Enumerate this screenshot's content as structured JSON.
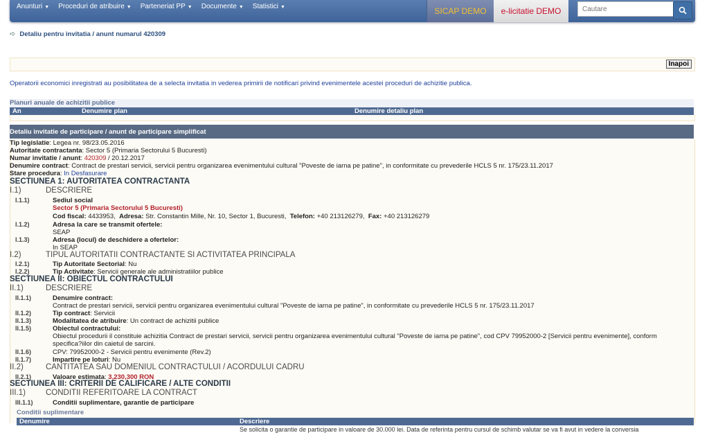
{
  "nav": {
    "menu": [
      "Anunturi",
      "Proceduri de atribuire",
      "Parteneriat PP",
      "Documente",
      "Statistici"
    ],
    "sicap": "SICAP DEMO",
    "elicitatie": "e-licitatie DEMO",
    "search_placeholder": "Cautare"
  },
  "breadcrumb": "Detaliu pentru invitatia / anunt numarul 420309",
  "back_label": "Inapoi",
  "notice": "Operatorii economici inregistrati au posibilitatea de a selecta invitatia in vederea primirii de notificari privind evenimentele acestei proceduri de achizitie publica.",
  "plans": {
    "title": "Planuri anuale de achizitii publice",
    "headers": [
      "An",
      "Denumire plan",
      "Denumire detaliu plan"
    ]
  },
  "detail": {
    "title": "Detaliu invitatie de participare / anunt de participare simplificat",
    "tip_label": "Tip legislatie",
    "tip_value": ": Legea nr. 98/23.05.2016",
    "autoritate_label": "Autoritate contractanta",
    "autoritate_value": ": Sector 5 (Primaria Sectorului 5 Bucuresti)",
    "numar_label": "Numar invitatie / anunt",
    "numar_value": "420309",
    "numar_date": " / 20.12.2017",
    "denumire_label": "Denumire contract",
    "denumire_value": ": Contract de prestari servicii, servicii pentru organizarea evenimentului cultural \"Poveste de iarna pe patine\", in conformitate cu prevederile HCLS 5 nr. 175/23.11.2017",
    "stare_label": "Stare procedura",
    "stare_value": "In Desfasurare"
  },
  "s1": {
    "title": "SECTIUNEA 1: AUTORITATEA CONTRACTANTA",
    "i1_num": "I.1)",
    "i1_title": "DESCRIERE",
    "r111_num": "I.1.1)",
    "r111_label": "Sediul social",
    "r111_name": "Sector 5 (Primaria Sectorului 5 Bucuresti)",
    "cod_label": "Cod fiscal:",
    "cod_value": "4433953,",
    "adresa_label": "Adresa:",
    "adresa_value": "Str. Constantin Mille, Nr. 10, Sector 1, Bucuresti,",
    "telefon_label": "Telefon:",
    "telefon_value": "+40 213126279,",
    "fax_label": "Fax:",
    "fax_value": "+40 213126279",
    "r112_num": "I.1.2)",
    "r112_label": "Adresa la care se transmit ofertele:",
    "r112_value": "SEAP",
    "r113_num": "I.1.3)",
    "r113_label": "Adresa (locul) de deschidere a ofertelor:",
    "r113_value": "In SEAP",
    "i2_num": "I.2)",
    "i2_title": "TIPUL AUTORITATII CONTRACTANTE SI ACTIVITATEA PRINCIPALA",
    "r121_num": "I.2.1)",
    "r121_label": "Tip Autoritate Sectorial",
    "r121_value": ": Nu",
    "r122_num": "I.2.2)",
    "r122_label": "Tip Activitate",
    "r122_value": ": Servicii generale ale administratiilor publice"
  },
  "s2": {
    "title": "SECTIUNEA II: OBIECTUL CONTRACTULUI",
    "ii1_num": "II.1)",
    "ii1_title": "DESCRIERE",
    "r211_num": "II.1.1)",
    "r211_label": "Denumire contract:",
    "r211_value": "Contract de prestari servicii, servicii pentru organizarea evenimentului cultural \"Poveste de iarna pe patine\", in conformitate cu prevederile HCLS 5 nr. 175/23.11.2017",
    "r212_num": "II.1.2)",
    "r212_label": "Tip contract",
    "r212_value": ": Servicii",
    "r213_num": "II.1.3)",
    "r213_label": "Modalitatea de atribuire",
    "r213_value": ": Un contract de achizitii publice",
    "r215_num": "II.1.5)",
    "r215_label": "Obiectul contractului:",
    "r215_value1": "Obiectul procedurii il constituie achizitia Contract de prestari servicii, servicii pentru organizarea evenimentului cultural \"Poveste de iarna pe patine\", cod CPV 79952000-2 [Servicii pentru evenimente], conform",
    "r215_value2": "specifica?iilor din caietul de sarcini.",
    "r216_num": "II.1.6)",
    "r216_value": "CPV: 79952000-2 - Servicii pentru evenimente (Rev.2)",
    "r217_num": "II.1.7)",
    "r217_label": "Impartire pe loturi",
    "r217_value": ": Nu",
    "ii2_num": "II.2)",
    "ii2_title": "CANTITATEA SAU DOMENIUL CONTRACTULUI / ACORDULUI CADRU",
    "r221_num": "II.2.1)",
    "r221_label": "Valoare estimata",
    "r221_value": "3,230,300 RON"
  },
  "s3": {
    "title": "SECTIUNEA III: CRITERII DE CALIFICARE / ALTE CONDITII",
    "iii1_num": "III.1)",
    "iii1_title": "CONDITII REFERITOARE LA CONTRACT",
    "r311_num": "III.1.1)",
    "r311_label": "Conditii suplimentare, garantie de participare",
    "cond_title": "Conditii suplimentare",
    "cond_headers": [
      "Denumire",
      "Descriere"
    ],
    "cond_cell": "Se solicita o garantie de participare in valoare de 30.000 lei. Data de referinta pentru cursul de schimb valutar se va fi avut in vedere la conversia"
  }
}
